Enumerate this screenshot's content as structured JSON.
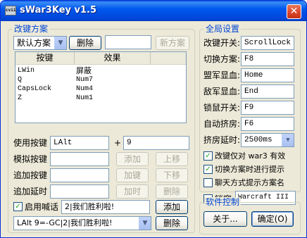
{
  "window": {
    "icon_text": "cvii",
    "title": "sWar3Key v1.5",
    "close_symbol": "✕"
  },
  "left_group": {
    "title": "改键方案",
    "scheme_select": "默认方案",
    "delete_button": "删除",
    "scheme_name_value": "",
    "new_scheme_button": "新方案",
    "list": {
      "headers": [
        "按键",
        "效果"
      ],
      "rows": [
        {
          "key": "LWin",
          "effect": "屏蔽"
        },
        {
          "key": "Q",
          "effect": "Num7"
        },
        {
          "key": "CapsLock",
          "effect": "Num4"
        },
        {
          "key": "Z",
          "effect": "Num1"
        }
      ]
    },
    "use_key_label": "使用按键",
    "use_key_value": "LAlt",
    "plus": "+",
    "use_key_value2": "9",
    "sim_key_label": "模拟按键",
    "add_button": "添加",
    "move_up_button": "上移",
    "append_key_label": "追加按键",
    "add_key_button": "加键",
    "move_down_button": "下移",
    "append_delay_label": "追加延时",
    "add_time_button": "加时",
    "delete_row_button": "删除",
    "shout_label": "启用喊话",
    "shout_value": "2|我们胜利啦!",
    "shout_add_button": "添加",
    "shout_select": "LAlt 9=-GC|2|我们胜利啦!",
    "shout_delete_button": "删除"
  },
  "right_group": {
    "title": "全局设置",
    "settings": [
      {
        "label": "改键开关:",
        "value": "ScrollLock"
      },
      {
        "label": "切换方案:",
        "value": "F8"
      },
      {
        "label": "盟军显血:",
        "value": "Home"
      },
      {
        "label": "敌军显血:",
        "value": "End"
      },
      {
        "label": "锁鼠开关:",
        "value": "F9"
      },
      {
        "label": "自动挤房:",
        "value": "F6"
      }
    ],
    "delay_label": "挤房延时:",
    "delay_value": "2500ms",
    "check_war3_only": "改键仅对 war3 有效",
    "check_switch_prompt": "切换方案时进行提示",
    "check_chat_prompt": "聊天方式提示方案名",
    "check_lock_window": "锁窗",
    "lock_window_value": "Warcraft III"
  },
  "control_group": {
    "title": "软件控制",
    "about_button": "关于...",
    "ok_button": "确定(O)"
  },
  "colors": {
    "titlebar": "#0058ee",
    "group_title": "#0046d5",
    "window_bg": "#ece9d8"
  }
}
